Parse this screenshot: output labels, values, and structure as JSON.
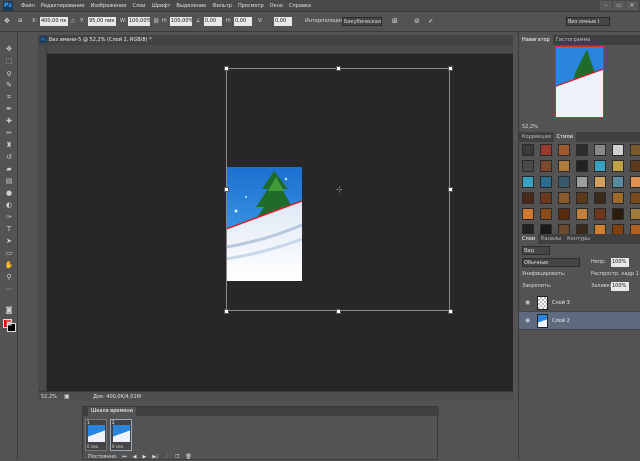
{
  "app": {
    "logo": "Ps"
  },
  "menu": [
    "Файл",
    "Редактирование",
    "Изображение",
    "Слои",
    "Шрифт",
    "Выделение",
    "Фильтр",
    "Просмотр",
    "Окно",
    "Справка"
  ],
  "window_controls": [
    "–",
    "▭",
    "✕"
  ],
  "options_bar": {
    "x_label": "X:",
    "x_value": "400,00 пк",
    "y_label": "Y:",
    "y_value": "95,00 пик",
    "w_label": "W:",
    "w_value": "100,00%",
    "h_label": "H:",
    "h_value": "100,00%",
    "angle_value": "0,00",
    "h_skew_label": "H:",
    "h_skew_value": "0,00",
    "v_skew_label": "V:",
    "v_skew_value": "0,00",
    "interp_label": "Интерполяция:",
    "interp_value": "Бикубическая",
    "workspace_value": "Виз омные I"
  },
  "document": {
    "tab_title": "Без имени-5 @ 52,2% (Слой 2, RGB/8) *",
    "zoom": "52,2%",
    "info": "Док: 400,0K/4,01M"
  },
  "navigator": {
    "tabs": [
      "Навигатор",
      "Гистограмма"
    ],
    "zoom": "52,2%"
  },
  "styles_panel": {
    "tabs": [
      "Коррекция",
      "Стили"
    ],
    "swatch_colors": [
      "#3a3a3a",
      "#9a3a2a",
      "#a05a30",
      "#2e2e2e",
      "#888",
      "#cfcfcf",
      "#7a5a2a",
      "#4a4a4a",
      "#7a4a2a",
      "#b07a3a",
      "#222",
      "#3aa0c0",
      "#c0a040",
      "#5a3a1a",
      "#3aa0c0",
      "#2a6a8a",
      "#3a5a6a",
      "#9aa0a0",
      "#d0a060",
      "#5a8aa0",
      "#e09050",
      "#4a2a1a",
      "#6a3a1a",
      "#8a5a2a",
      "#5a3a1a",
      "#3a2a1a",
      "#a06a2a",
      "#7a4a1a",
      "#d07a30",
      "#8a4a1a",
      "#5a2a0a",
      "#c08040",
      "#6a3a1a",
      "#2a1a0a",
      "#a07a3a",
      "#222222",
      "#1a1a1a",
      "#6a4a2a",
      "#3a2a1a",
      "#d08030",
      "#804010",
      "#b06020"
    ]
  },
  "layers_panel": {
    "tabs": [
      "Слои",
      "Каналы",
      "Контуры"
    ],
    "kind": "Вид",
    "blend_mode": "Обычные",
    "opacity_label": "Непр:",
    "opacity_value": "100%",
    "unify_label": "Унифицировать:",
    "propagate_label": "Распростр. кадр 1",
    "lock_label": "Закрепить:",
    "fill_label": "Заливка:",
    "fill_value": "100%",
    "layers": [
      {
        "name": "Слой 3"
      },
      {
        "name": "Слой 2"
      }
    ]
  },
  "timeline": {
    "title": "Шкала времени",
    "frames": [
      {
        "num": "1",
        "delay": "0 сек."
      },
      {
        "num": "2",
        "delay": "0 сек."
      }
    ],
    "loop": "Постоянно"
  }
}
